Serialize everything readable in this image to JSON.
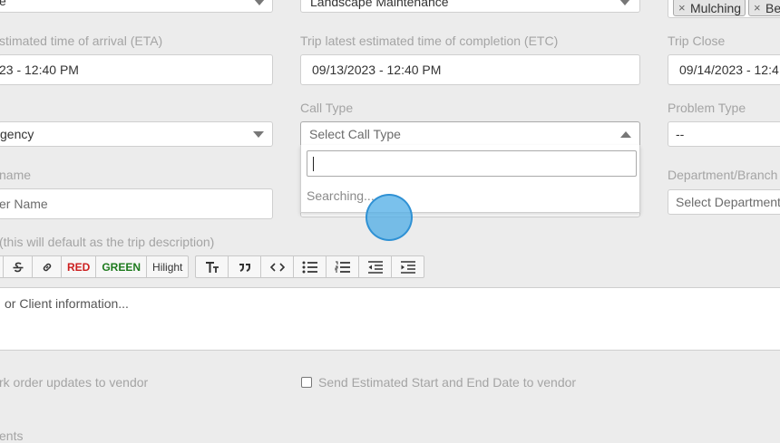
{
  "top_row": {
    "left_select_fragment": "e",
    "middle_select_value": "Landscape Maintenance",
    "tags": [
      "Mulching",
      "Be"
    ]
  },
  "row1": {
    "eta_label": "stimated time of arrival (ETA)",
    "eta_value": "23 - 12:40 PM",
    "etc_label": "Trip latest estimated time of completion (ETC)",
    "etc_value": "09/13/2023 - 12:40 PM",
    "close_label": "Trip Close",
    "close_value": "09/14/2023 - 12:4"
  },
  "row2": {
    "priority_value": "gency",
    "call_type_label": "Call Type",
    "call_type_placeholder": "Select Call Type",
    "problem_type_label": "Problem Type",
    "problem_type_value": "--"
  },
  "dropdown": {
    "search_value": "",
    "status_text": "Searching..."
  },
  "row3": {
    "name_label": "name",
    "name_placeholder": "er Name",
    "department_label": "Department/Branch",
    "department_placeholder": "Select Department"
  },
  "description": {
    "label": "(this will default as the trip description)",
    "placeholder": "or Client information...",
    "toolbar_group1": [
      "strike-icon",
      "link-icon",
      "RED",
      "GREEN",
      "Hilight"
    ],
    "toolbar_group2": [
      "text-size-icon",
      "quote-icon",
      "code-icon",
      "bullet-list-icon",
      "numbered-list-icon",
      "outdent-icon",
      "indent-icon"
    ]
  },
  "options": {
    "updates_text": "rk order updates to vendor",
    "send_dates_text": "Send Estimated Start and End Date to vendor",
    "bottom_fragment": "ents"
  }
}
